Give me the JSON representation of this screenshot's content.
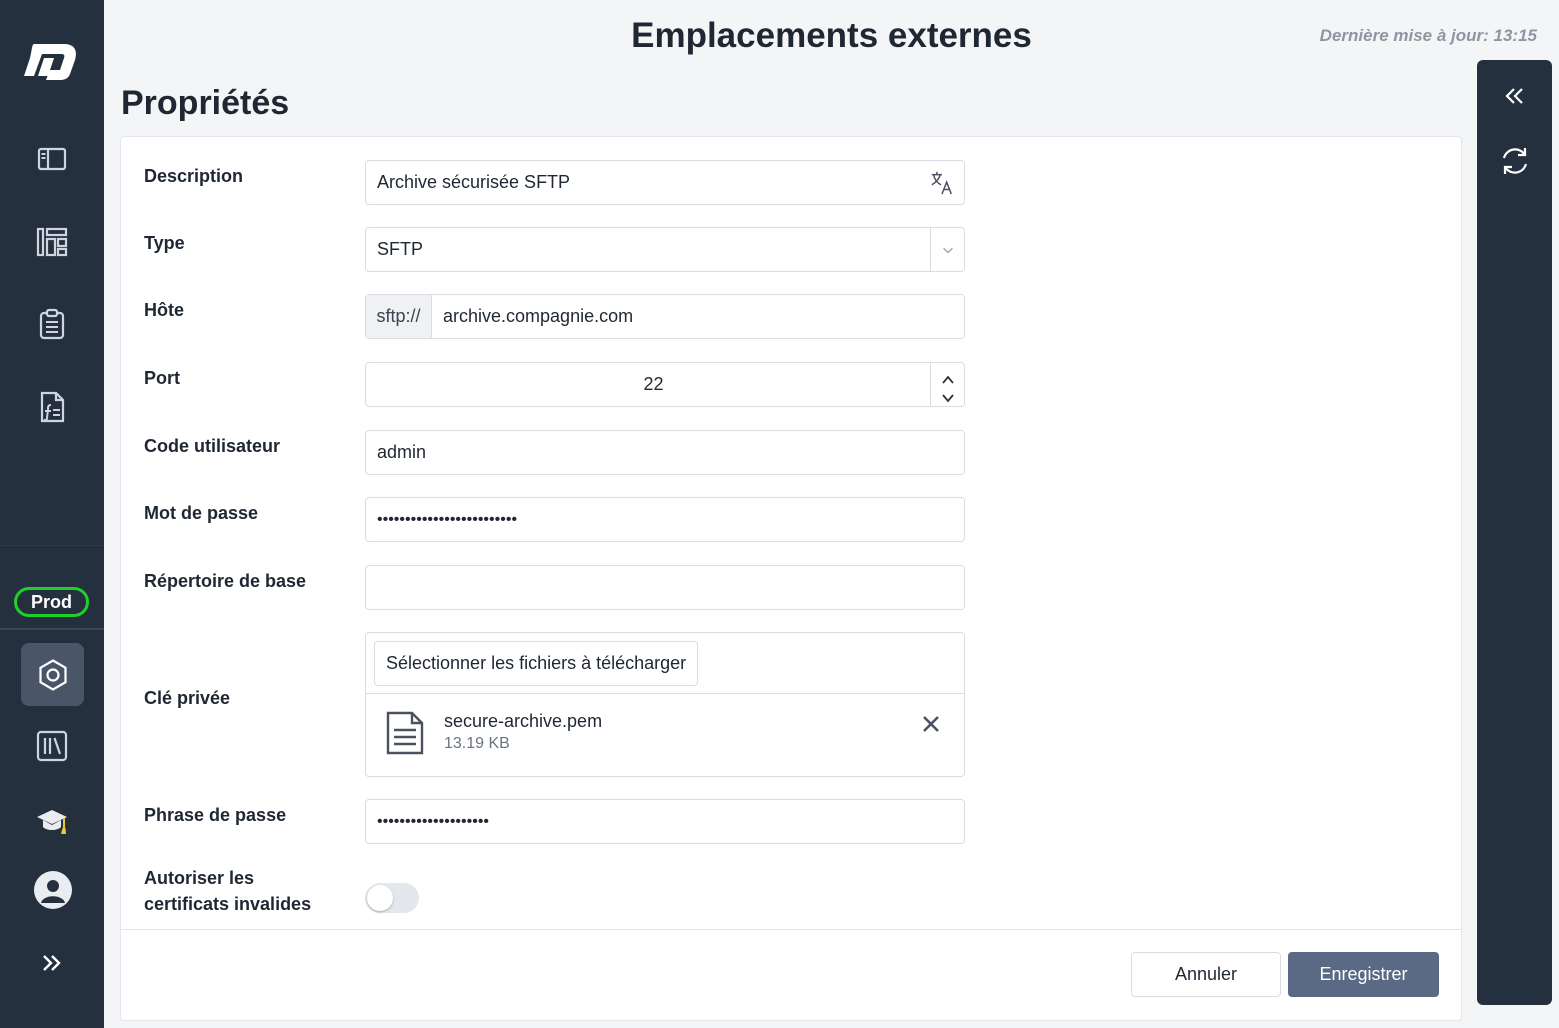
{
  "header": {
    "title": "Emplacements externes",
    "last_update": "Dernière mise à jour: 13:15",
    "section_title": "Propriétés"
  },
  "sidebar": {
    "items": [
      {
        "icon": "sidebar-panel-icon"
      },
      {
        "icon": "dashboard-icon"
      },
      {
        "icon": "clipboard-icon"
      },
      {
        "icon": "function-document-icon"
      }
    ],
    "environment_badge": "Prod",
    "bottom_items": [
      {
        "icon": "settings-hexagon-icon",
        "active": true
      },
      {
        "icon": "library-icon"
      },
      {
        "icon": "graduation-cap-icon"
      },
      {
        "icon": "user-avatar-icon"
      },
      {
        "icon": "expand-double-chevron-icon"
      }
    ]
  },
  "right_panel": {
    "items": [
      {
        "icon": "collapse-double-chevron-icon"
      },
      {
        "icon": "refresh-icon"
      }
    ]
  },
  "form": {
    "description": {
      "label": "Description",
      "value": "Archive sécurisée SFTP"
    },
    "type": {
      "label": "Type",
      "value": "SFTP"
    },
    "host": {
      "label": "Hôte",
      "prefix": "sftp://",
      "value": "archive.compagnie.com"
    },
    "port": {
      "label": "Port",
      "value": "22"
    },
    "user_code": {
      "label": "Code utilisateur",
      "value": "admin"
    },
    "password": {
      "label": "Mot de passe",
      "value": "•••••••••••••••••••••••••"
    },
    "base_dir": {
      "label": "Répertoire de base",
      "value": ""
    },
    "private_key": {
      "label": "Clé privée",
      "upload_label": "Sélectionner les fichiers à télécharger",
      "file_name": "secure-archive.pem",
      "file_size": "13.19 KB"
    },
    "passphrase": {
      "label": "Phrase de passe",
      "value": "••••••••••••••••••••"
    },
    "allow_invalid_certs": {
      "label_line1": "Autoriser les",
      "label_line2": "certificats invalides",
      "enabled": false
    }
  },
  "actions": {
    "cancel": "Annuler",
    "save": "Enregistrer"
  },
  "colors": {
    "sidebar_bg": "#25303f",
    "env_badge_border": "#1fcf2a",
    "primary_button": "#5a6a84"
  }
}
